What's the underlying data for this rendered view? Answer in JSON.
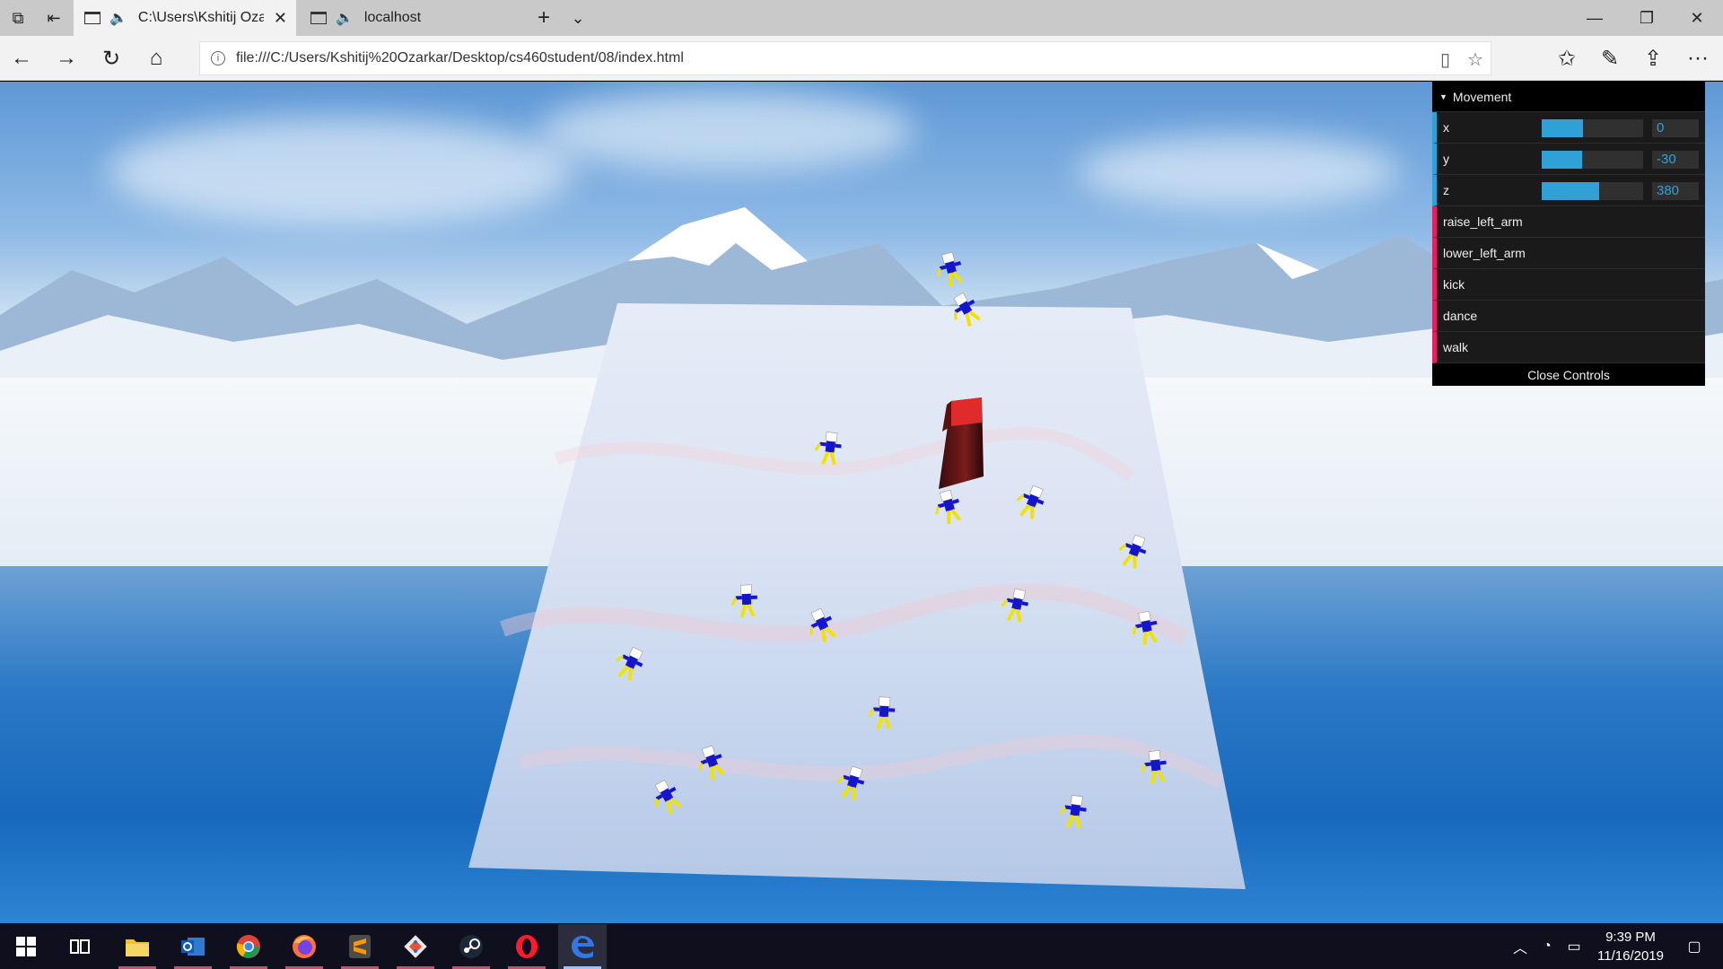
{
  "browser": {
    "tabs": [
      {
        "title": "C:\\Users\\Kshitij Oza",
        "active": true,
        "audio_icon": "speaker-icon"
      },
      {
        "title": "localhost",
        "active": false,
        "audio_icon": "speaker-icon"
      }
    ],
    "new_tab_label": "+",
    "tab_menu_label": "⌄",
    "window_controls": {
      "minimize": "—",
      "restore": "❐",
      "close": "✕"
    },
    "address": "file:///C:/Users/Kshitij%20Ozarkar/Desktop/cs460student/08/index.html",
    "nav": {
      "back": "←",
      "forward": "→",
      "refresh": "↻",
      "home": "⌂"
    },
    "toolbar_icons": [
      "reading-view-icon",
      "favorite-star-icon",
      "favorites-hub-icon",
      "pen-icon",
      "share-icon",
      "more-icon"
    ],
    "more_label": "···"
  },
  "gui": {
    "folder": "Movement",
    "sliders": [
      {
        "label": "x",
        "value": "0",
        "fill_fraction": 0.41
      },
      {
        "label": "y",
        "value": "-30",
        "fill_fraction": 0.4
      },
      {
        "label": "z",
        "value": "380",
        "fill_fraction": 0.57
      }
    ],
    "functions": [
      "raise_left_arm",
      "lower_left_arm",
      "kick",
      "dance",
      "walk"
    ],
    "close": "Close Controls",
    "colors": {
      "number_accent": "#2fa1d6",
      "function_accent": "#e61d5f",
      "background": "#1a1a1a"
    }
  },
  "scene": {
    "object_count": 17,
    "colors": {
      "robot_body": "#1515cc",
      "robot_limbs": "#f2e200",
      "robot_head": "#ffffff",
      "pillar": "#7a1d1d",
      "pillar_top": "#e02b2b"
    }
  },
  "taskbar": {
    "apps": [
      "start-windows-icon",
      "task-view-icon",
      "file-explorer-icon",
      "outlook-icon",
      "chrome-icon",
      "firefox-icon",
      "sublime-text-icon",
      "git-icon",
      "steam-icon",
      "opera-icon",
      "edge-icon"
    ],
    "time": "9:39 PM",
    "date": "11/16/2019"
  }
}
